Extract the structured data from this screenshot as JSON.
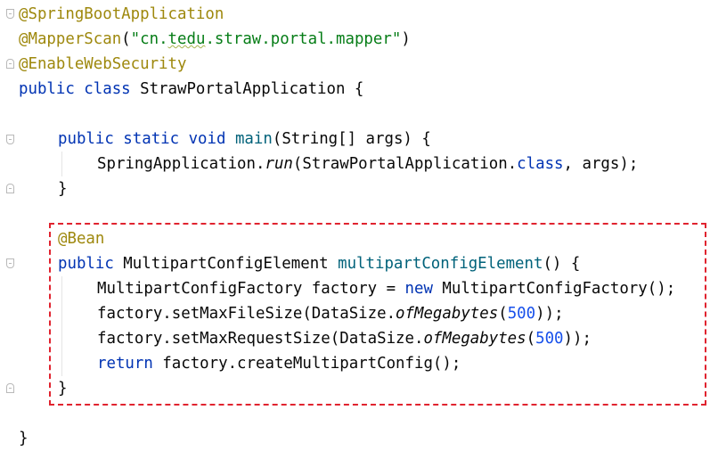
{
  "code": {
    "l1_ann": "@SpringBootApplication",
    "l2_ann": "@MapperScan",
    "l2_paren_open": "(",
    "l2_str": "\"cn.tedu.straw.portal.mapper\"",
    "l2_paren_close": ")",
    "l3_ann": "@EnableWebSecurity",
    "l4_kw": "public class",
    "l4_rest": " StrawPortalApplication {",
    "l6_kw": "public static void",
    "l6_sp": " ",
    "l6_fn": "main",
    "l6_rest": "(String[] args) {",
    "l7_a": "SpringApplication.",
    "l7_run": "run",
    "l7_b": "(StrawPortalApplication.",
    "l7_kw": "class",
    "l7_c": ", args);",
    "l8_close": "}",
    "l10_ann": "@Bean",
    "l11_kw": "public",
    "l11_type": " MultipartConfigElement ",
    "l11_fn": "multipartConfigElement",
    "l11_rest": "() {",
    "l12_a": "MultipartConfigFactory factory = ",
    "l12_kw": "new",
    "l12_b": " MultipartConfigFactory();",
    "l13_a": "factory.setMaxFileSize(DataSize.",
    "l13_it": "ofMegabytes",
    "l13_p": "(",
    "l13_num": "500",
    "l13_end": "));",
    "l14_a": "factory.setMaxRequestSize(DataSize.",
    "l14_it": "ofMegabytes",
    "l14_p": "(",
    "l14_num": "500",
    "l14_end": "));",
    "l15_kw": "return",
    "l15_rest": " factory.createMultipartConfig();",
    "l16_close": "}",
    "l18_close": "}"
  },
  "colors": {
    "annotation": "#9e880d",
    "keyword": "#0033b3",
    "string": "#067d17",
    "number": "#1750eb",
    "method": "#00627a",
    "highlight_border": "#e0232f"
  }
}
